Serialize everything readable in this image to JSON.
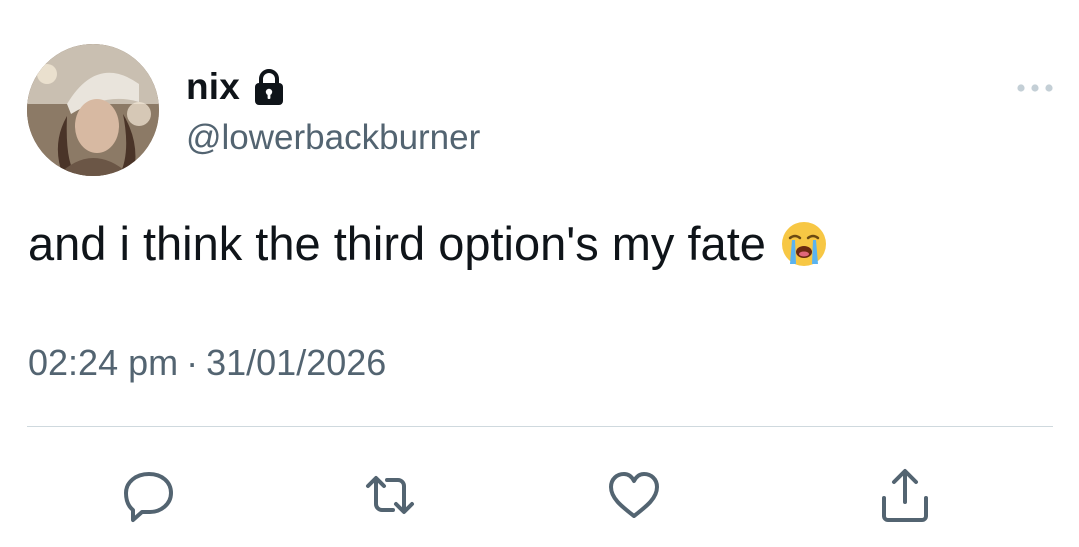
{
  "user": {
    "display_name": "nix",
    "handle": "@lowerbackburner",
    "avatar_icon": "avatar-photo",
    "protected_icon": "lock-icon"
  },
  "tweet": {
    "text": "and i think the third option's my fate",
    "emoji": "loudly-crying-face",
    "time": "02:24 pm",
    "separator": "·",
    "date": "31/01/2026"
  },
  "actions": [
    {
      "name": "reply",
      "icon": "reply-icon"
    },
    {
      "name": "retweet",
      "icon": "retweet-icon"
    },
    {
      "name": "like",
      "icon": "heart-icon"
    },
    {
      "name": "share",
      "icon": "share-icon"
    }
  ],
  "colors": {
    "primary_text": "#0f1419",
    "secondary_text": "#536471",
    "divider": "#cfd9de",
    "icon": "#536471"
  }
}
